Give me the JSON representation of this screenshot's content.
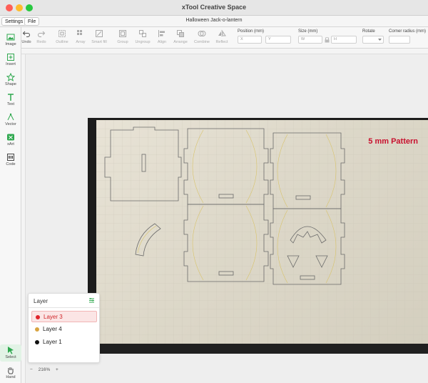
{
  "window": {
    "title": "xTool Creative Space"
  },
  "menu": {
    "settings": "Settings",
    "file": "File",
    "document_title": "Halloween Jack-o-lantern"
  },
  "toolbar": {
    "tools": [
      {
        "id": "undo",
        "label": "Undo",
        "icon": "undo-icon",
        "enabled": true
      },
      {
        "id": "redo",
        "label": "Redo",
        "icon": "redo-icon",
        "enabled": false
      },
      {
        "id": "outline",
        "label": "Outline",
        "icon": "outline-icon",
        "enabled": false
      },
      {
        "id": "array",
        "label": "Array",
        "icon": "array-icon",
        "enabled": false
      },
      {
        "id": "smartfill",
        "label": "Smart fill",
        "icon": "smart-fill-icon",
        "enabled": false
      },
      {
        "id": "group",
        "label": "Group",
        "icon": "group-icon",
        "enabled": false
      },
      {
        "id": "ungroup",
        "label": "Ungroup",
        "icon": "ungroup-icon",
        "enabled": false
      },
      {
        "id": "align",
        "label": "Align",
        "icon": "align-icon",
        "enabled": false
      },
      {
        "id": "arrange",
        "label": "Arrange",
        "icon": "arrange-icon",
        "enabled": false
      },
      {
        "id": "combine",
        "label": "Combine",
        "icon": "combine-icon",
        "enabled": false
      },
      {
        "id": "reflect",
        "label": "Reflect",
        "icon": "reflect-icon",
        "enabled": false
      }
    ],
    "position": {
      "label": "Position (mm)",
      "x_placeholder": "X",
      "y_placeholder": "Y"
    },
    "size": {
      "label": "Size (mm)",
      "w_placeholder": "W",
      "h_placeholder": "H"
    },
    "rotate": {
      "label": "Rotate"
    },
    "corner": {
      "label": "Corner radius (mm)"
    }
  },
  "sidebar": {
    "items": [
      {
        "label": "Image",
        "icon": "image-icon"
      },
      {
        "label": "Insert",
        "icon": "insert-icon"
      },
      {
        "label": "Shape",
        "icon": "shape-icon"
      },
      {
        "label": "Text",
        "icon": "text-icon"
      },
      {
        "label": "Vector",
        "icon": "vector-icon"
      },
      {
        "label": "xArt",
        "icon": "xart-icon"
      },
      {
        "label": "Code",
        "icon": "code-icon"
      }
    ],
    "bottom": [
      {
        "label": "Select",
        "icon": "select-icon",
        "active": true
      },
      {
        "label": "Hand",
        "icon": "hand-icon",
        "active": false
      }
    ]
  },
  "canvas": {
    "pattern_label": "5 mm Pattern"
  },
  "layers": {
    "title": "Layer",
    "items": [
      {
        "name": "Layer 3",
        "color": "#e0242b",
        "selected": true
      },
      {
        "name": "Layer 4",
        "color": "#d9a441",
        "selected": false
      },
      {
        "name": "Layer 1",
        "color": "#111111",
        "selected": false
      }
    ]
  },
  "zoom": {
    "minus": "−",
    "value": "216%",
    "plus": "+"
  },
  "colors": {
    "accent": "#2fa84f",
    "layer_selected": "#e0242b",
    "pattern_label": "#c8102e"
  }
}
